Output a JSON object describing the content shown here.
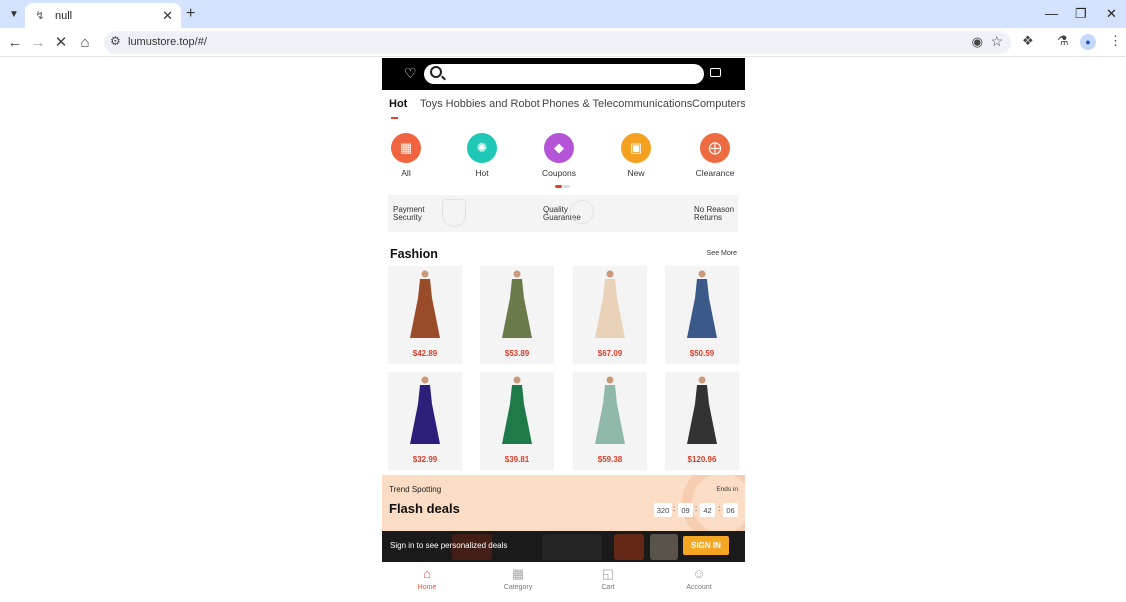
{
  "browser": {
    "tab_title": "null",
    "tab_favicon": "loading-favicon-icon",
    "url": "lumustore.top/#/"
  },
  "store": {
    "categories": [
      "Hot",
      "Toys Hobbies and Robot",
      "Phones & Telecommunications",
      "Computers &"
    ],
    "active_category": "Hot",
    "quick_links": [
      {
        "label": "All",
        "icon": "grid-icon",
        "color": "#f0643f"
      },
      {
        "label": "Hot",
        "icon": "hot-badge-icon",
        "color": "#1fc8b6"
      },
      {
        "label": "Coupons",
        "icon": "tag-icon",
        "color": "#b455d8"
      },
      {
        "label": "New",
        "icon": "box-icon",
        "color": "#f4a020"
      },
      {
        "label": "Clearance",
        "icon": "compass-icon",
        "color": "#ee6a40"
      }
    ],
    "trust_badges": [
      "Payment Security",
      "Quality Guarantee",
      "No Reason Returns"
    ],
    "section_title": "Fashion",
    "see_more": "See More",
    "products": [
      {
        "price": "$42.89",
        "color": "#9a4b2a"
      },
      {
        "price": "$53.89",
        "color": "#6b7a4a"
      },
      {
        "price": "$67.09",
        "color": "#ead2b8"
      },
      {
        "price": "$50.59",
        "color": "#3b5a8a"
      },
      {
        "price": "$32.99",
        "color": "#2b1f7a"
      },
      {
        "price": "$39.81",
        "color": "#1f7a4a"
      },
      {
        "price": "$59.38",
        "color": "#8fb8a8"
      },
      {
        "price": "$120.96",
        "color": "#333333"
      }
    ],
    "flash": {
      "kicker": "Trend Spotting",
      "title": "Flash deals",
      "ends_label": "Ends in",
      "countdown": [
        "320",
        "09",
        "42",
        "06"
      ]
    },
    "signin_banner": {
      "text": "Sign in to see personalized deals",
      "button": "SIGN IN"
    },
    "bottom_nav": [
      {
        "label": "Home",
        "active": true
      },
      {
        "label": "Category",
        "active": false
      },
      {
        "label": "Cart",
        "active": false
      },
      {
        "label": "Account",
        "active": false
      }
    ],
    "accent_color": "#e0452c"
  }
}
